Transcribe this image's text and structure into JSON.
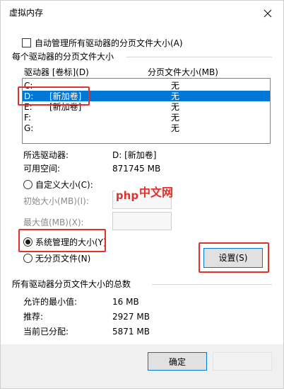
{
  "window": {
    "title": "虚拟内存"
  },
  "auto_manage": {
    "label": "自动管理所有驱动器的分页文件大小(A)",
    "checked": false
  },
  "per_drive": {
    "group_label": "每个驱动器的分页文件大小",
    "col_drive": "驱动器 [卷标](D)",
    "col_size": "分页文件大小(MB)",
    "rows": [
      {
        "drive": "C:",
        "label": "",
        "size": "无"
      },
      {
        "drive": "D:",
        "label": "[新加卷]",
        "size": "无"
      },
      {
        "drive": "E:",
        "label": "[新加卷]",
        "size": "无"
      },
      {
        "drive": "F:",
        "label": "",
        "size": "无"
      },
      {
        "drive": "G:",
        "label": "",
        "size": "无"
      }
    ],
    "selected_index": 1
  },
  "selected_drive": {
    "label": "所选驱动器:",
    "value": "D:  [新加卷]",
    "space_label": "可用空间:",
    "space_value": "871745 MB"
  },
  "options": {
    "custom_label": "自定义大小(C):",
    "initial_label": "初始大小(MB)(I):",
    "max_label": "最大值(MB)(X):",
    "system_managed_label": "系统管理的大小(Y)",
    "no_paging_label": "无分页文件(N)",
    "selected": "system_managed"
  },
  "set_button": "设置(S)",
  "totals": {
    "group_label": "所有驱动器分页文件大小的总数",
    "min_label": "允许的最小值:",
    "min_value": "16 MB",
    "rec_label": "推荐:",
    "rec_value": "2927 MB",
    "cur_label": "当前已分配:",
    "cur_value": "5871 MB"
  },
  "ok_button": "确定",
  "watermark": {
    "badge": "php",
    "text": "中文网"
  },
  "colors": {
    "selection": "#0078d7",
    "annotation_red": "#e0322b"
  }
}
